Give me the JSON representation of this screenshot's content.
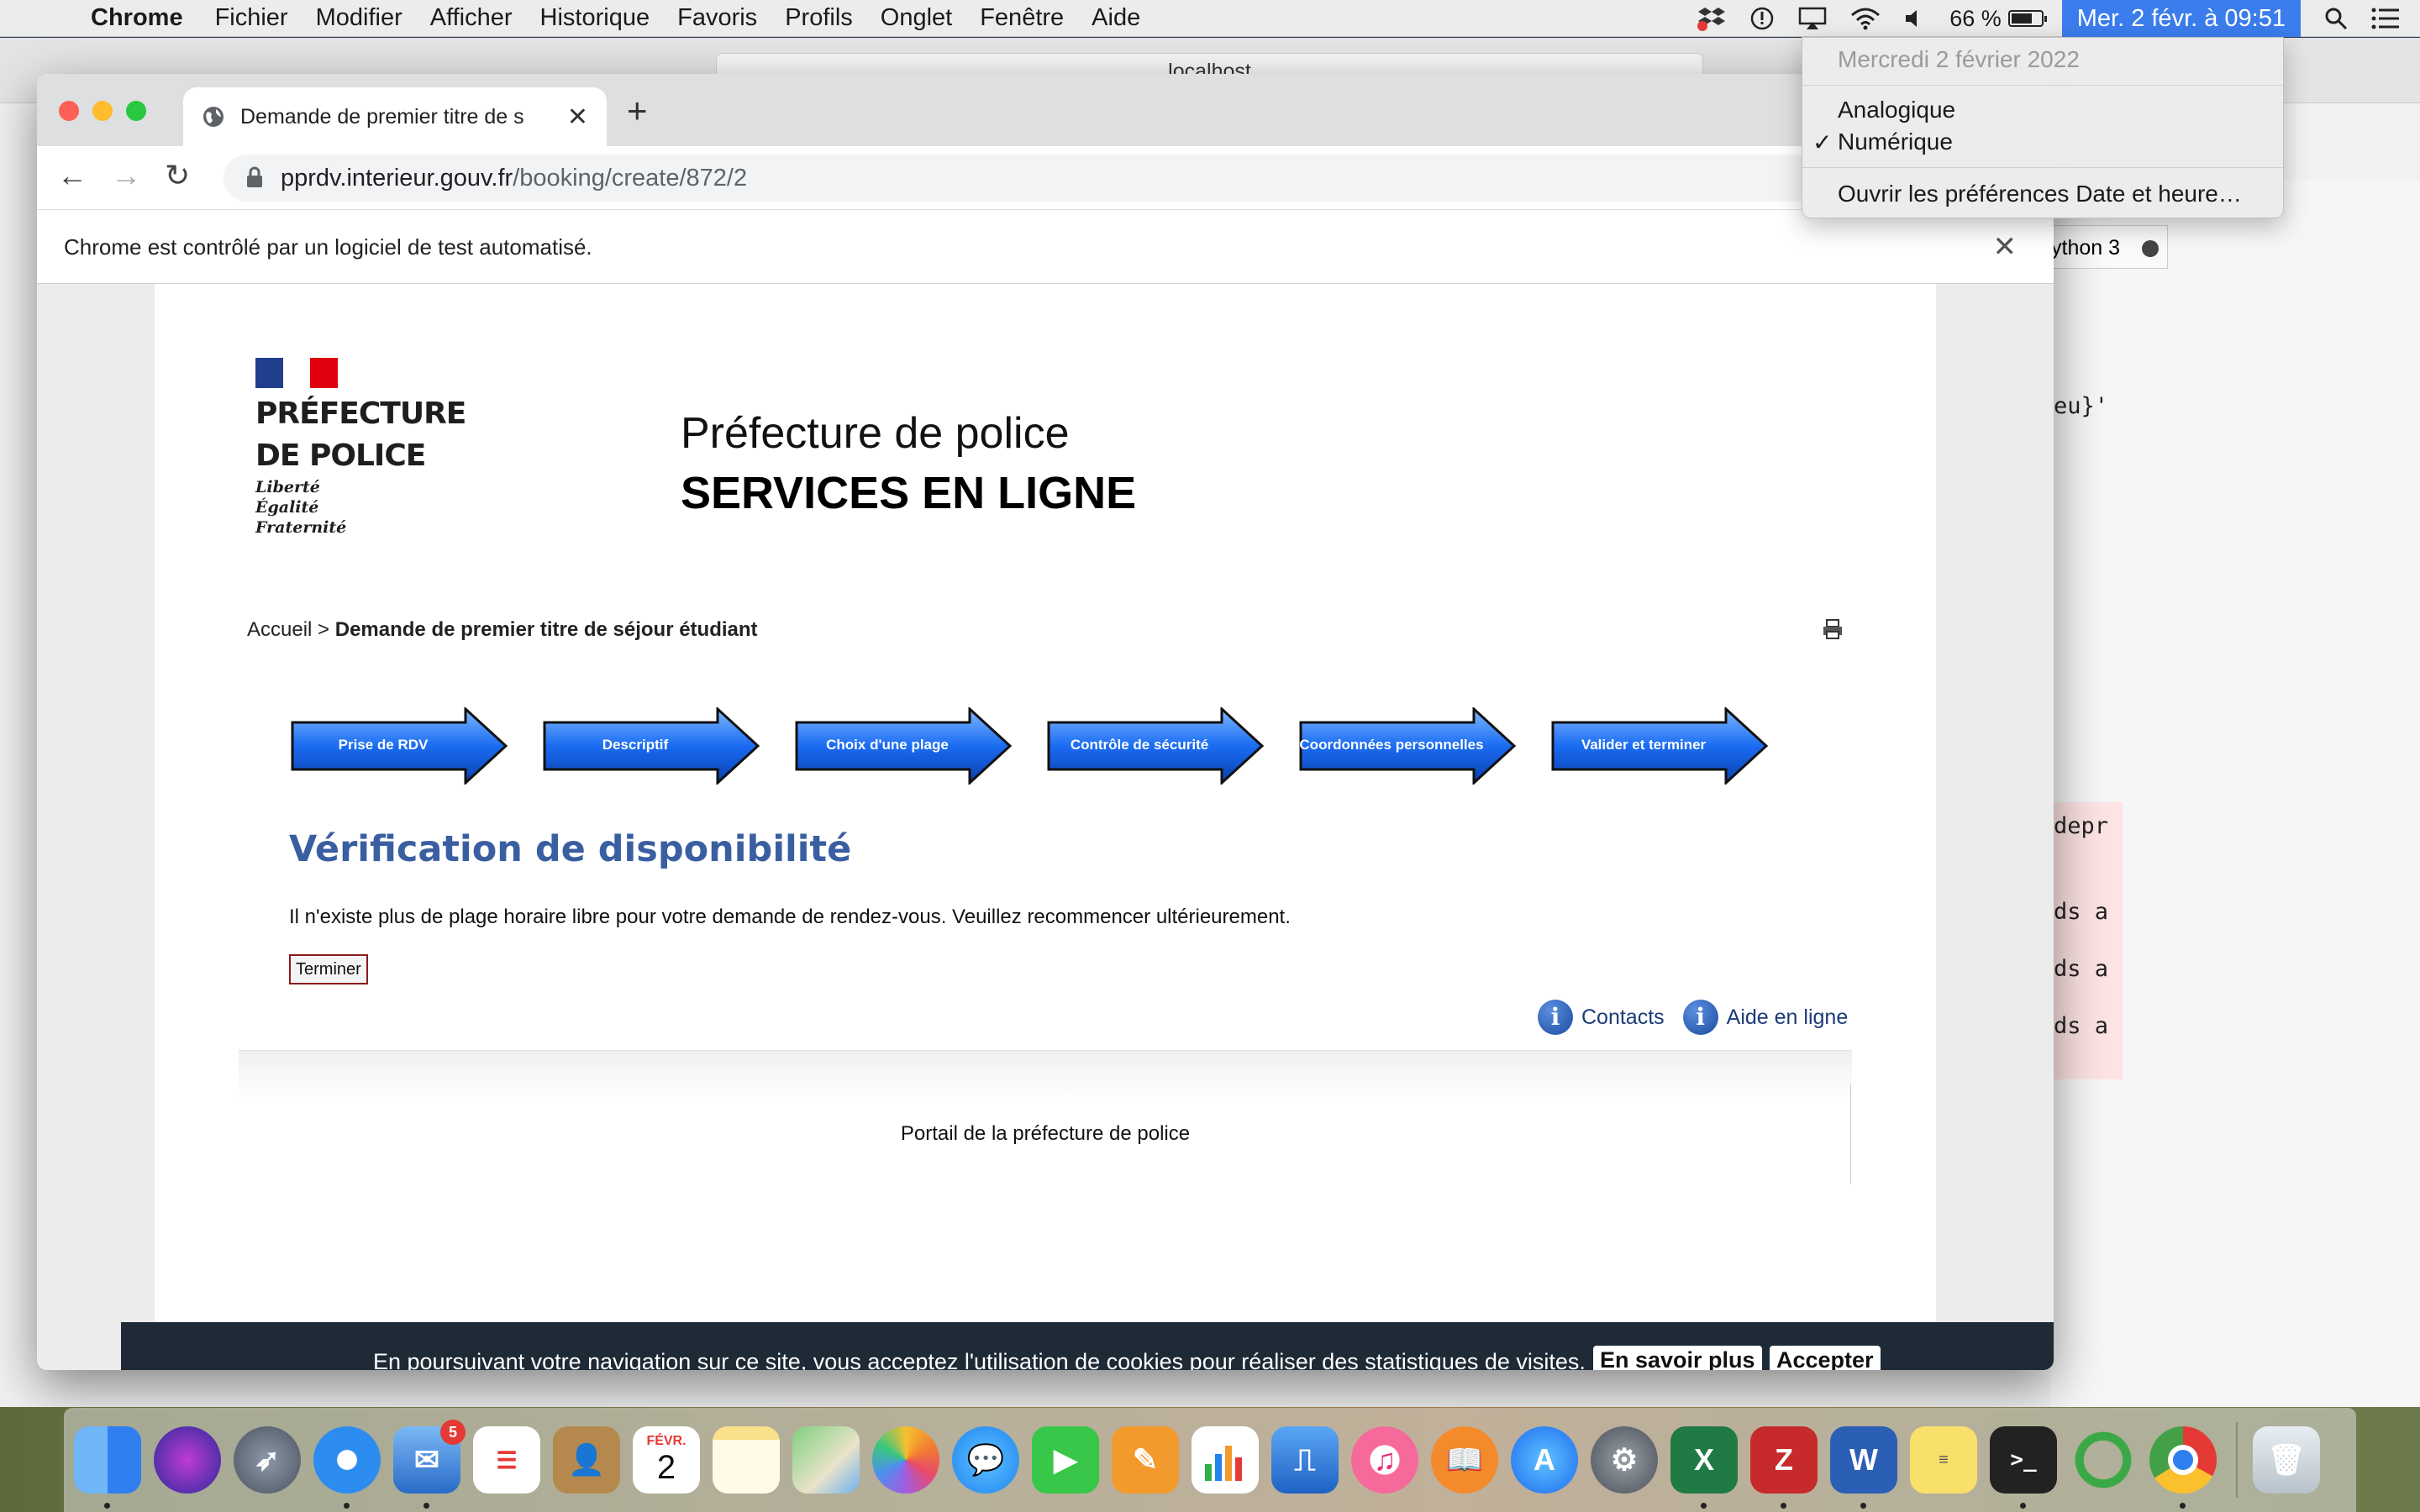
{
  "menubar": {
    "app_name": "Chrome",
    "items": [
      "Fichier",
      "Modifier",
      "Afficher",
      "Historique",
      "Favoris",
      "Profils",
      "Onglet",
      "Fenêtre",
      "Aide"
    ],
    "battery": "66 %",
    "clock": "Mer. 2 févr. à  09:51"
  },
  "clock_menu": {
    "date": "Mercredi 2 février 2022",
    "analog": "Analogique",
    "digital": "Numérique",
    "prefs": "Ouvrir les préférences Date et heure…"
  },
  "background_window": {
    "url": "localhost",
    "kernel": "ython 3",
    "code_lines": [
      "eu}'",
      "depr",
      "ds a",
      "ds a",
      "ds a"
    ]
  },
  "browser": {
    "tab_title": "Demande de premier titre de s",
    "url_host": "pprdv.interieur.gouv.fr",
    "url_path": "/booking/create/872/2",
    "infobar": "Chrome est contrôlé par un logiciel de test automatisé."
  },
  "page": {
    "logo_line1": "PRÉFECTURE",
    "logo_line2": "DE POLICE",
    "motto": [
      "Liberté",
      "Égalité",
      "Fraternité"
    ],
    "title1": "Préfecture de police",
    "title2": "SERVICES EN LIGNE",
    "breadcrumb_home": "Accueil",
    "breadcrumb_sep": " > ",
    "breadcrumb_current": "Demande de premier titre de séjour étudiant",
    "steps": [
      "Prise de RDV",
      "Descriptif",
      "Choix d'une plage",
      "Contrôle de sécurité",
      "Coordonnées personnelles",
      "Valider et terminer"
    ],
    "heading": "Vérification de disponibilité",
    "message": "Il n'existe plus de plage horaire libre pour votre demande de rendez-vous. Veuillez recommencer ultérieurement.",
    "button_finish": "Terminer",
    "link_contacts": "Contacts",
    "link_help": "Aide en ligne",
    "footer": "Portail de la préfecture de police",
    "cookie_text": "En poursuivant votre navigation sur ce site, vous acceptez l'utilisation de cookies pour réaliser des statistiques de visites.",
    "cookie_more": "En savoir plus",
    "cookie_accept": "Accepter"
  },
  "dock": {
    "apps": [
      "finder-icon",
      "siri-icon",
      "launchpad-icon",
      "safari-icon",
      "mail-icon",
      "reminders-icon",
      "contacts-icon",
      "calendar-icon",
      "notes-icon",
      "maps-icon",
      "photos-icon",
      "messages-icon",
      "facetime-icon",
      "pages-icon",
      "numbers-icon",
      "keynote-icon",
      "itunes-icon",
      "books-icon",
      "app-store-icon",
      "system-preferences-icon",
      "excel-icon",
      "filezilla-icon",
      "word-icon",
      "stickies-icon",
      "terminal-icon",
      "sync-icon",
      "chrome-icon"
    ],
    "mail_badge": "5",
    "calendar_month": "FÉVR.",
    "calendar_day": "2"
  }
}
